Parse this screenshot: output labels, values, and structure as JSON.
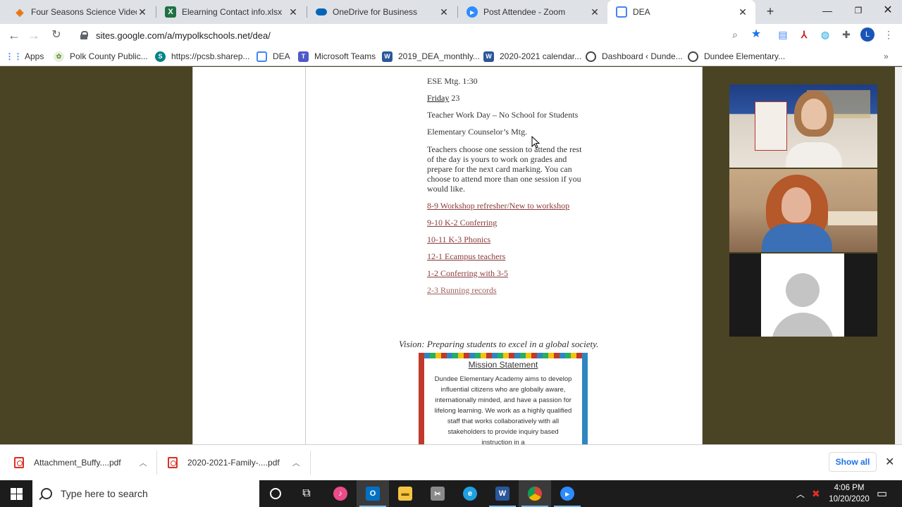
{
  "browser": {
    "tabs": [
      {
        "label": "Four Seasons Science Video F",
        "icon": "orange-diamond-icon",
        "color": "#e8710a"
      },
      {
        "label": "Elearning Contact info.xlsx",
        "icon": "excel-icon",
        "color": "#1e7145"
      },
      {
        "label": "OneDrive for Business",
        "icon": "onedrive-icon",
        "color": "#0364b8"
      },
      {
        "label": "Post Attendee - Zoom",
        "icon": "zoom-icon",
        "color": "#2d8cff"
      },
      {
        "label": "DEA",
        "icon": "google-sites-icon",
        "color": "#4285f4"
      }
    ],
    "url": "sites.google.com/a/mypolkschools.net/dea/",
    "profile_initial": "L",
    "bookmarks": [
      {
        "label": "Apps",
        "icon": "apps-grid-icon"
      },
      {
        "label": "Polk County Public...",
        "icon": "polk-icon"
      },
      {
        "label": "https://pcsb.sharep...",
        "icon": "sharepoint-icon"
      },
      {
        "label": "DEA",
        "icon": "google-sites-icon"
      },
      {
        "label": "Microsoft Teams",
        "icon": "teams-icon"
      },
      {
        "label": "2019_DEA_monthly...",
        "icon": "word-icon"
      },
      {
        "label": "2020-2021 calendar...",
        "icon": "word-icon"
      },
      {
        "label": "Dashboard ‹ Dunde...",
        "icon": "globe-icon"
      },
      {
        "label": "Dundee Elementary...",
        "icon": "globe-icon"
      }
    ]
  },
  "page": {
    "ese_meeting": "ESE Mtg. 1:30",
    "friday_label": "Friday",
    "friday_date": "23",
    "work_day": "Teacher Work Day – No School for Students",
    "counselor": "Elementary Counselor’s Mtg.",
    "instructions": "Teachers choose one session to attend the rest of the day is yours to work on grades and prepare for the next card marking.  You can choose to attend more than one session if you would like.",
    "sessions": [
      "8-9 Workshop refresher/New to workshop",
      "9-10 K-2 Conferring",
      "10-11 K-3 Phonics",
      "12-1 Ecampus teachers",
      "1-2 Conferring with 3-5",
      "2-3 Running records"
    ],
    "vision": "Vision: Preparing students to excel in a global society.",
    "mission_title": "Mission Statement",
    "mission_text": "Dundee Elementary Academy aims to develop influential citizens who are globally aware, internationally minded, and have a passion for lifelong learning. We work as a highly qualified staff that works collaboratively with all stakeholders to provide inquiry based instruction in a"
  },
  "downloads": [
    {
      "label": "Attachment_Buffy....pdf"
    },
    {
      "label": "2020-2021-Family-....pdf"
    }
  ],
  "downloads_show_all": "Show all",
  "taskbar": {
    "search_placeholder": "Type here to search",
    "time": "4:06 PM",
    "date": "10/20/2020"
  }
}
